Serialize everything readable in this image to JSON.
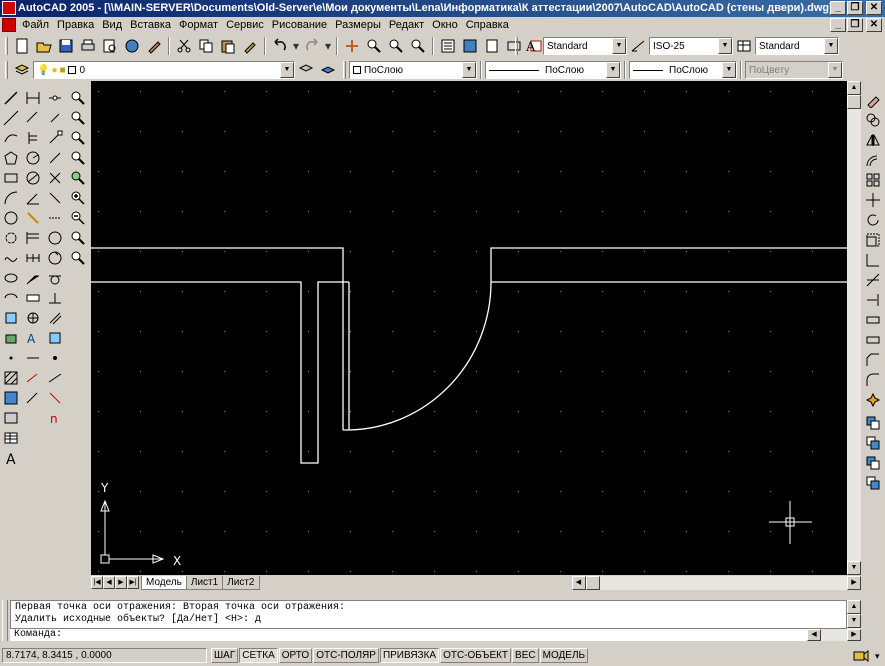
{
  "window": {
    "title": "AutoCAD 2005 - [\\\\MAIN-SERVER\\Documents\\Old-Server\\e\\Мои документы\\Lena\\Информатика\\К аттестации\\2007\\AutoCAD\\AutoCAD (стены двери).dwg]",
    "minimize": "_",
    "restore": "❐",
    "close": "✕"
  },
  "menu": {
    "items": [
      "Файл",
      "Правка",
      "Вид",
      "Вставка",
      "Формат",
      "Сервис",
      "Рисование",
      "Размеры",
      "Редакт",
      "Окно",
      "Справка"
    ]
  },
  "styles": {
    "text_style": "Standard",
    "dim_style": "ISO-25",
    "table_style": "Standard"
  },
  "layers": {
    "current_layer": "0",
    "color": "ПоСлою",
    "linetype": "ПоСлою",
    "lineweight": "ПоСлою",
    "plotstyle": "ПоЦвету"
  },
  "ucs": {
    "x_label": "X",
    "y_label": "Y"
  },
  "layout_tabs": {
    "tabs": [
      "Модель",
      "Лист1",
      "Лист2"
    ],
    "active": "Модель"
  },
  "command": {
    "history_line1": "Первая точка оси отражения: Вторая точка оси отражения:",
    "history_line2": "Удалить исходные объекты? [Да/Нет] <Н>: д",
    "prompt": "Команда:"
  },
  "status": {
    "coords": "8.7174, 8.3415 , 0.0000",
    "modes": [
      {
        "label": "ШАГ",
        "on": false
      },
      {
        "label": "СЕТКА",
        "on": true
      },
      {
        "label": "ОРТО",
        "on": false
      },
      {
        "label": "ОТС-ПОЛЯР",
        "on": false
      },
      {
        "label": "ПРИВЯЗКА",
        "on": true
      },
      {
        "label": "ОТС-ОБЪЕКТ",
        "on": false
      },
      {
        "label": "ВЕС",
        "on": false
      },
      {
        "label": "МОДЕЛЬ",
        "on": false
      }
    ]
  },
  "colors": {
    "canvas_bg": "#000000",
    "drawing_line": "#ffffff",
    "grid_dot": "#808080",
    "titlebar": "#0a246a"
  }
}
